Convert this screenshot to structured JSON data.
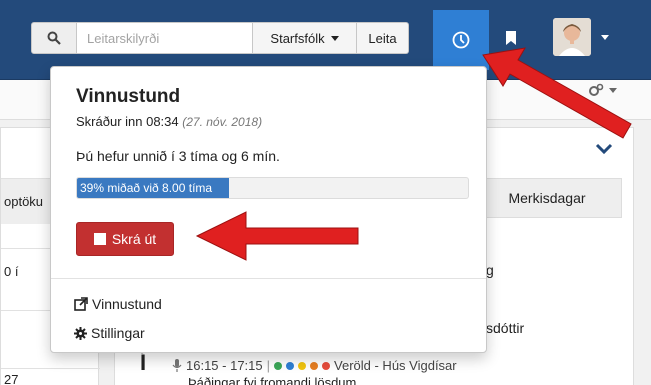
{
  "navbar": {
    "search_placeholder": "Leitarskilyrði",
    "staff_dropdown": "Starfsfólk",
    "search_button": "Leita"
  },
  "background": {
    "left_tab_fragment": "optöku",
    "left_row1_fragment": "0 í",
    "left_row2_fragment": "27",
    "right_tab": "Merkisdagar",
    "right_row1_fragment": "g",
    "right_row2_fragment": "sdóttir",
    "event_big_letter": "Í",
    "event_time": "16:15 - 17:15",
    "event_title": "Veröld - Hús Vigdísar",
    "event_sub": "Þáðingar fyi fromandi lösdum",
    "event_dot_colors": [
      "#3aa657",
      "#2f7fd4",
      "#f1c40f",
      "#e67e22",
      "#e74c3c"
    ]
  },
  "popover": {
    "title": "Vinnustund",
    "checkin_label": "Skráður inn 08:34",
    "checkin_date": "(27. nóv. 2018)",
    "worked_text": "Þú hefur unnið í 3 tíma og 6 mín.",
    "progress_label": "39% miðað við 8.00 tíma",
    "progress_fraction": 0.39,
    "checkout_label": "Skrá út",
    "link_vinnustund": "Vinnustund",
    "link_stillingar": "Stillingar"
  },
  "colors": {
    "navbar_bg": "#234a7b",
    "clock_active": "#2f7fd4",
    "checkout_red": "#c23030",
    "arrow_red": "#e02020",
    "progress_blue": "#3a79c1"
  }
}
